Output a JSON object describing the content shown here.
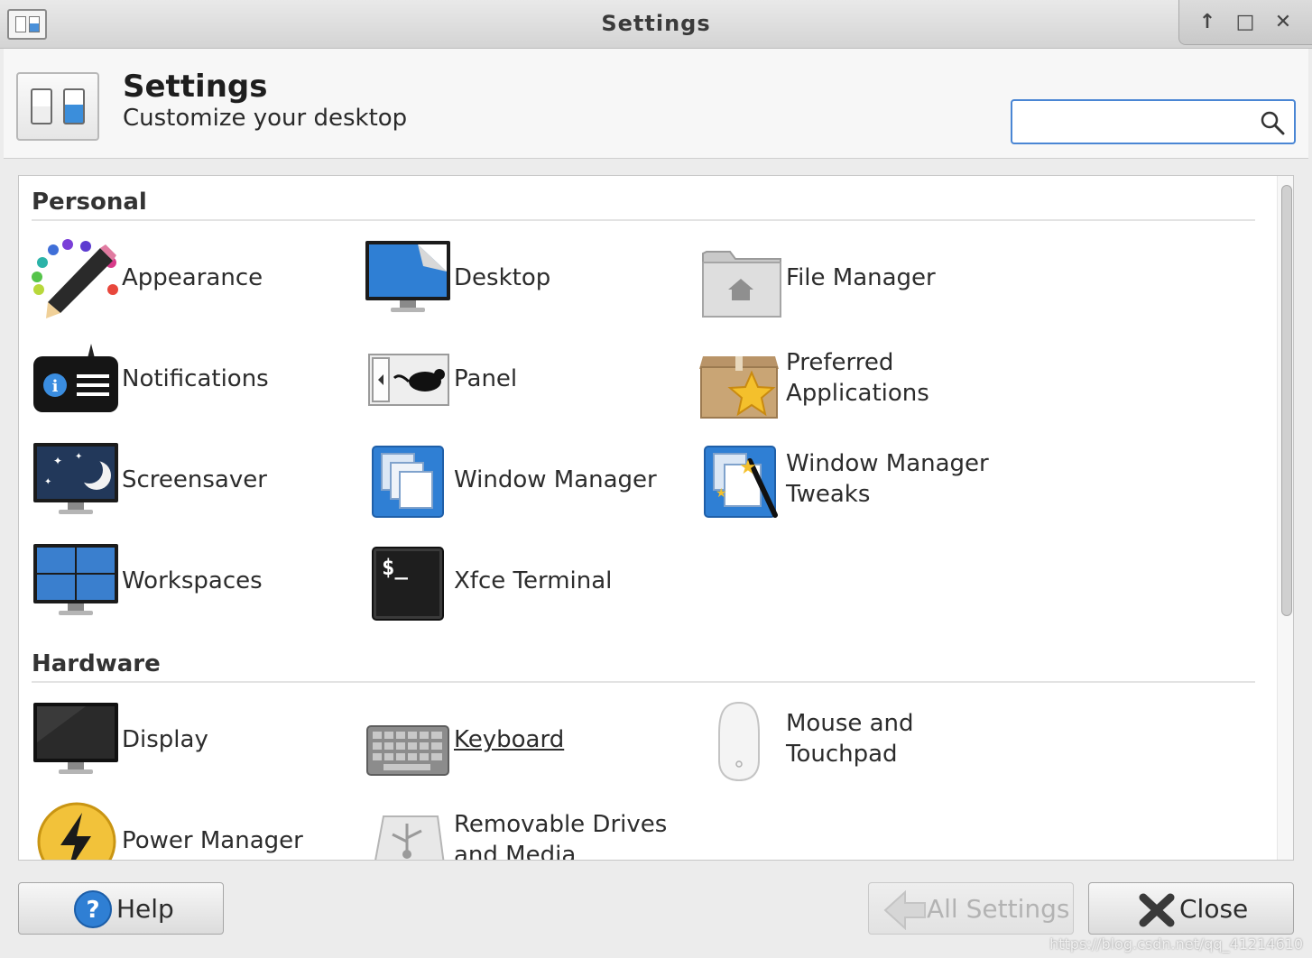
{
  "window": {
    "title": "Settings",
    "controls": [
      "↑",
      "□",
      "✕"
    ]
  },
  "header": {
    "title": "Settings",
    "subtitle": "Customize your desktop",
    "search_value": "",
    "search_placeholder": ""
  },
  "sections": [
    {
      "title": "Personal",
      "items": [
        {
          "label": "Appearance",
          "icon": "appearance-icon"
        },
        {
          "label": "Desktop",
          "icon": "desktop-icon"
        },
        {
          "label": "File Manager",
          "icon": "file-manager-icon"
        },
        {
          "label": "Notifications",
          "icon": "notifications-icon"
        },
        {
          "label": "Panel",
          "icon": "panel-icon"
        },
        {
          "label_line1": "Preferred",
          "label_line2": "Applications",
          "icon": "preferred-applications-icon"
        },
        {
          "label": "Screensaver",
          "icon": "screensaver-icon"
        },
        {
          "label": "Window Manager",
          "icon": "window-manager-icon"
        },
        {
          "label_line1": "Window Manager",
          "label_line2": "Tweaks",
          "icon": "window-manager-tweaks-icon"
        },
        {
          "label": "Workspaces",
          "icon": "workspaces-icon"
        },
        {
          "label": "Xfce Terminal",
          "icon": "terminal-icon"
        }
      ]
    },
    {
      "title": "Hardware",
      "items": [
        {
          "label": "Display",
          "icon": "display-icon"
        },
        {
          "label": "Keyboard",
          "icon": "keyboard-icon"
        },
        {
          "label_line1": "Mouse and",
          "label_line2": "Touchpad",
          "icon": "mouse-icon"
        },
        {
          "label": "Power Manager",
          "icon": "power-manager-icon"
        },
        {
          "label_line1": "Removable Drives",
          "label_line2": "and Media",
          "icon": "usb-icon"
        }
      ]
    }
  ],
  "footer": {
    "help": "Help",
    "all_settings": "All Settings",
    "close": "Close"
  },
  "watermark": "https://blog.csdn.net/qq_41214610"
}
